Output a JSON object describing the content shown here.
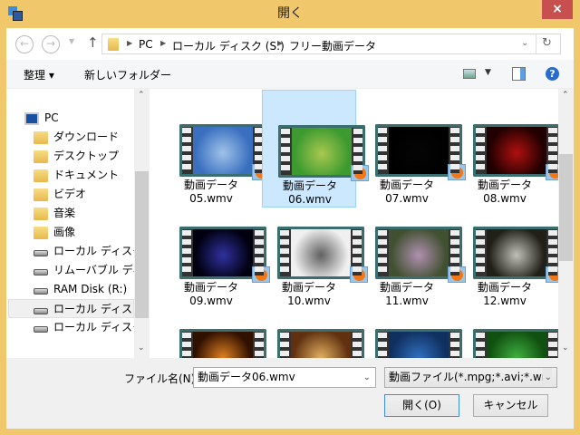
{
  "window": {
    "title": "開く",
    "close_label": "×"
  },
  "address": {
    "crumbs": [
      "PC",
      "ローカル ディスク (S:)",
      "フリー動画データ"
    ]
  },
  "toolbar": {
    "organize": "整理 ▾",
    "new_folder": "新しいフォルダー"
  },
  "nav": {
    "items": [
      {
        "label": "PC",
        "icon": "pc-icon"
      },
      {
        "label": "ダウンロード",
        "icon": "downloads-folder-icon"
      },
      {
        "label": "デスクトップ",
        "icon": "desktop-folder-icon"
      },
      {
        "label": "ドキュメント",
        "icon": "documents-folder-icon"
      },
      {
        "label": "ビデオ",
        "icon": "videos-folder-icon"
      },
      {
        "label": "音楽",
        "icon": "music-folder-icon"
      },
      {
        "label": "画像",
        "icon": "pictures-folder-icon"
      },
      {
        "label": "ローカル ディスク (C:)",
        "icon": "system-drive-icon"
      },
      {
        "label": "リムーバブル ディスク",
        "icon": "removable-drive-icon"
      },
      {
        "label": "RAM Disk (R:)",
        "icon": "drive-icon"
      },
      {
        "label": "ローカル ディスク (S:)",
        "icon": "drive-icon",
        "selected": true
      },
      {
        "label": "ローカル ディスク (X:)",
        "icon": "drive-icon"
      }
    ]
  },
  "files": [
    {
      "name1": "動画データ",
      "name2": "05.wmv",
      "colors": [
        "#3a6fc0",
        "#9fc3e8",
        "#5a7a60"
      ]
    },
    {
      "name1": "動画データ",
      "name2": "06.wmv",
      "colors": [
        "#3c9a30",
        "#a8c850",
        "#2a7020"
      ],
      "selected": true
    },
    {
      "name1": "動画データ",
      "name2": "07.wmv",
      "colors": [
        "#000000",
        "#050505",
        "#100500"
      ]
    },
    {
      "name1": "動画データ",
      "name2": "08.wmv",
      "colors": [
        "#200000",
        "#b01010",
        "#300000"
      ]
    },
    {
      "name1": "動画データ",
      "name2": "09.wmv",
      "colors": [
        "#000010",
        "#3030a0",
        "#000010"
      ]
    },
    {
      "name1": "動画データ",
      "name2": "10.wmv",
      "colors": [
        "#f0f0f0",
        "#606060",
        "#e8e8e8"
      ]
    },
    {
      "name1": "動画データ",
      "name2": "11.wmv",
      "colors": [
        "#405030",
        "#b090b0",
        "#304020"
      ]
    },
    {
      "name1": "動画データ",
      "name2": "12.wmv",
      "colors": [
        "#202018",
        "#c0c0b8",
        "#707068"
      ]
    },
    {
      "name1": "",
      "name2": "",
      "colors": [
        "#301000",
        "#e08020",
        "#a04000"
      ]
    },
    {
      "name1": "",
      "name2": "",
      "colors": [
        "#603010",
        "#e0b060",
        "#c04020"
      ]
    },
    {
      "name1": "",
      "name2": "",
      "colors": [
        "#103060",
        "#3070c0",
        "#603030"
      ]
    },
    {
      "name1": "",
      "name2": "",
      "colors": [
        "#105010",
        "#40b040",
        "#207020"
      ]
    }
  ],
  "bottom": {
    "filename_label": "ファイル名(N):",
    "filename_value": "動画データ06.wmv",
    "filetype": "動画ファイル(*.mpg;*.avi;*.wr",
    "open": "開く(O)",
    "cancel": "キャンセル"
  }
}
